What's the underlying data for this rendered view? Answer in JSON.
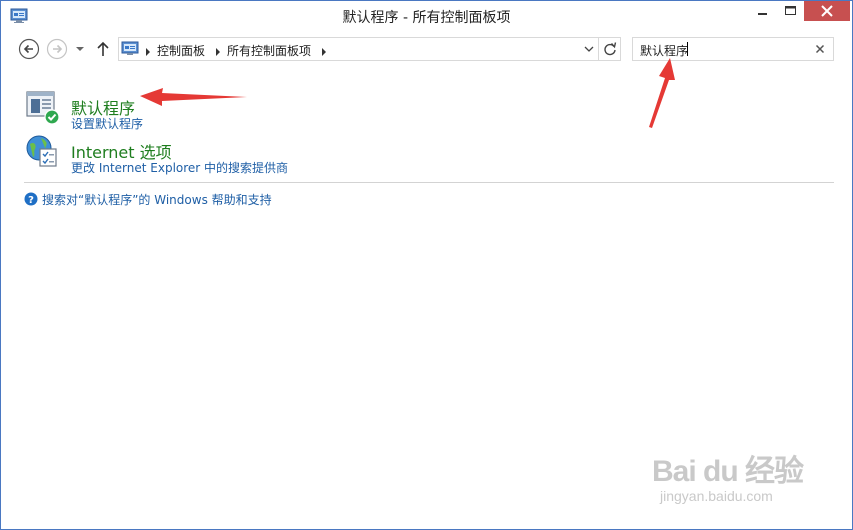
{
  "window": {
    "title": "默认程序 - 所有控制面板项",
    "controls": {
      "minimize": "minimize",
      "maximize": "maximize",
      "close": "close"
    }
  },
  "navigation": {
    "breadcrumbs": [
      "控制面板",
      "所有控制面板项"
    ],
    "search": {
      "value": "默认程序"
    }
  },
  "results": [
    {
      "title": "默认程序",
      "link": "设置默认程序",
      "icon": "default-programs-icon"
    },
    {
      "title": "Internet 选项",
      "link": "更改 Internet Explorer 中的搜索提供商",
      "icon": "internet-options-icon"
    }
  ],
  "help": {
    "text": "搜索对“默认程序”的 Windows 帮助和支持",
    "icon": "help-icon"
  },
  "watermark": {
    "logo": "Bai du 经验",
    "url": "jingyan.baidu.com"
  },
  "colors": {
    "window_border": "#4a78c2",
    "close_button": "#c75050",
    "result_title": "#1e7d1e",
    "link": "#1f5fa6",
    "annotation_arrow": "#e53935"
  }
}
